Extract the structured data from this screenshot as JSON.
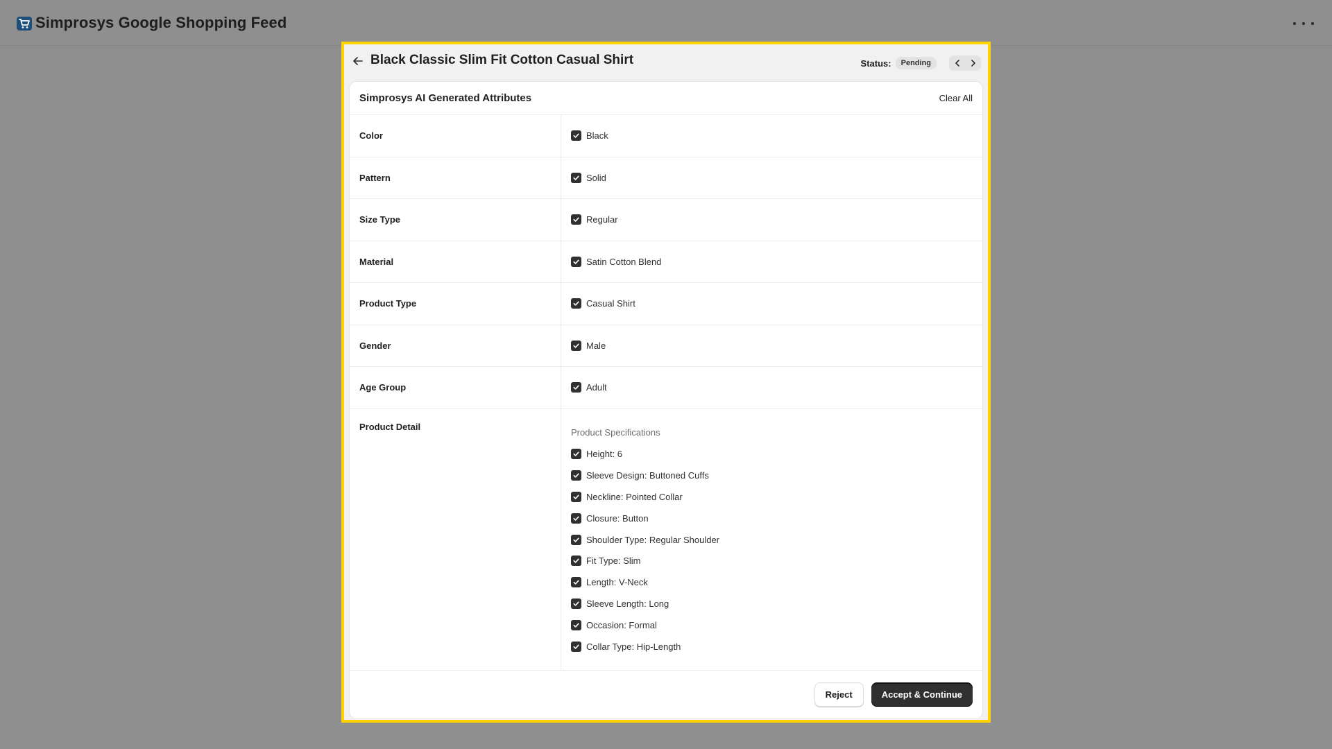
{
  "app": {
    "title": "Simprosys Google Shopping Feed",
    "logo_icon": "shopping-cart-icon",
    "menu_icon": "more-horizontal-icon"
  },
  "modal": {
    "title": "Black Classic Slim Fit Cotton Casual Shirt",
    "status_label": "Status:",
    "status_value": "Pending",
    "highlight_color": "#ffd400"
  },
  "card": {
    "title": "Simprosys AI Generated Attributes",
    "clear_all_label": "Clear All"
  },
  "attributes": [
    {
      "label": "Color",
      "value": "Black",
      "checked": true
    },
    {
      "label": "Pattern",
      "value": "Solid",
      "checked": true
    },
    {
      "label": "Size Type",
      "value": "Regular",
      "checked": true
    },
    {
      "label": "Material",
      "value": "Satin Cotton Blend",
      "checked": true
    },
    {
      "label": "Product Type",
      "value": "Casual Shirt",
      "checked": true
    },
    {
      "label": "Gender",
      "value": "Male",
      "checked": true
    },
    {
      "label": "Age Group",
      "value": "Adult",
      "checked": true
    }
  ],
  "product_detail": {
    "label": "Product Detail",
    "heading": "Product Specifications",
    "items": [
      {
        "value": "Height: 6",
        "checked": true
      },
      {
        "value": "Sleeve Design: Buttoned Cuffs",
        "checked": true
      },
      {
        "value": "Neckline: Pointed Collar",
        "checked": true
      },
      {
        "value": "Closure: Button",
        "checked": true
      },
      {
        "value": "Shoulder Type: Regular Shoulder",
        "checked": true
      },
      {
        "value": "Fit Type: Slim",
        "checked": true
      },
      {
        "value": "Length: V-Neck",
        "checked": true
      },
      {
        "value": "Sleeve Length: Long",
        "checked": true
      },
      {
        "value": "Occasion: Formal",
        "checked": true
      },
      {
        "value": "Collar Type: Hip-Length",
        "checked": true
      }
    ]
  },
  "footer": {
    "reject_label": "Reject",
    "accept_label": "Accept & Continue"
  }
}
